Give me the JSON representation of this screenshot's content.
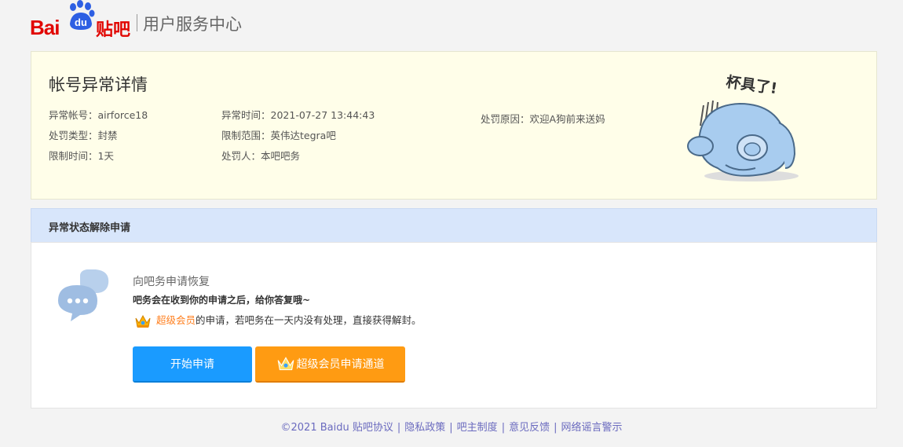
{
  "header": {
    "logo_bai": "Bai",
    "logo_du": "du",
    "logo_tieba": "贴吧",
    "title": "用户服务中心"
  },
  "detail": {
    "title": "帐号异常详情",
    "fields": [
      {
        "label": "异常帐号：",
        "value": "airforce18"
      },
      {
        "label": "异常时间：",
        "value": "2021-07-27 13:44:43"
      },
      {
        "label": "处罚原因：",
        "value": "欢迎A狗前来送妈"
      },
      {
        "label": "处罚类型：",
        "value": "封禁"
      },
      {
        "label": "限制范围：",
        "value": "英伟达tegra吧"
      },
      {
        "label": "限制时间：",
        "value": "1天"
      },
      {
        "label": "处罚人：",
        "value": "本吧吧务"
      }
    ],
    "illustration_text": "杯具了!"
  },
  "appeal": {
    "header": "异常状态解除申请",
    "title": "向吧务申请恢复",
    "subtitle": "吧务会在收到你的申请之后，给你答复哦~",
    "vip_link": "超级会员",
    "vip_note": "的申请，若吧务在一天内没有处理，直接获得解封。",
    "start_button": "开始申请",
    "vip_button": "超级会员申请通道"
  },
  "footer": {
    "copyright": "©2021 Baidu",
    "links": [
      "贴吧协议",
      "隐私政策",
      "吧主制度",
      "意见反馈",
      "网络谣言警示"
    ]
  },
  "colors": {
    "brand_red": "#e10601",
    "detail_bg": "#fffee9",
    "appeal_header_bg": "#d8e6fb",
    "primary_button": "#1a9bff",
    "vip_button": "#ff9b12",
    "vip_text": "#ff7e1c",
    "footer_link": "#6b6bbf"
  }
}
